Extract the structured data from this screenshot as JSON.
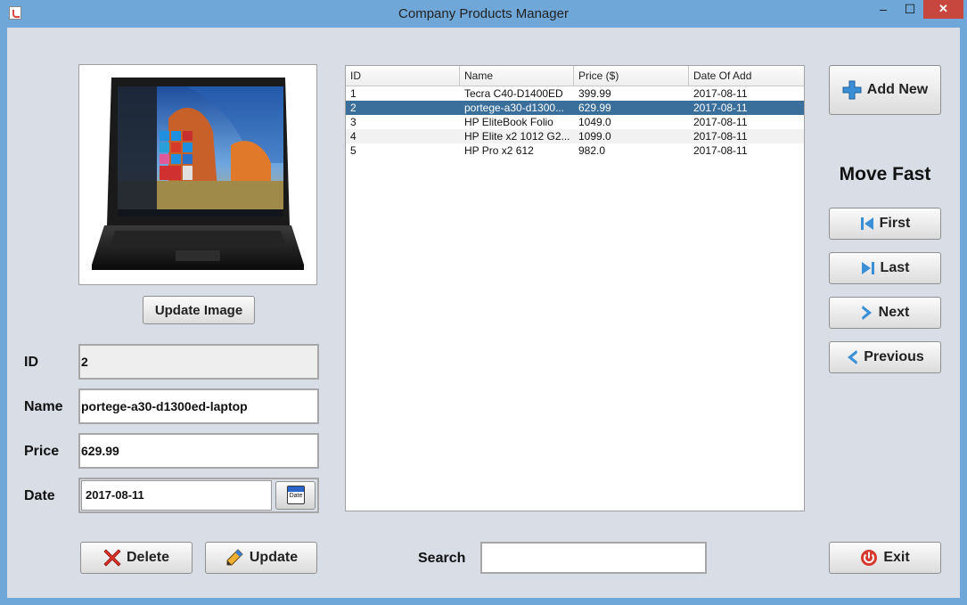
{
  "window": {
    "title": "Company Products Manager",
    "min_glyph": "–",
    "max_glyph": "☐",
    "close_glyph": "✕"
  },
  "image_panel": {
    "update_label": "Update Image"
  },
  "form": {
    "id_label": "ID",
    "id_value": "2",
    "name_label": "Name",
    "name_value": "portege-a30-d1300ed-laptop",
    "price_label": "Price",
    "price_value": "629.99",
    "date_label": "Date",
    "date_value": "2017-08-11",
    "date_button_label": "Date"
  },
  "table": {
    "columns": [
      "ID",
      "Name",
      "Price ($)",
      "Date Of Add"
    ],
    "rows": [
      [
        "1",
        "Tecra C40-D1400ED",
        "399.99",
        "2017-08-11"
      ],
      [
        "2",
        "portege-a30-d1300...",
        "629.99",
        "2017-08-11"
      ],
      [
        "3",
        "HP EliteBook Folio",
        "1049.0",
        "2017-08-11"
      ],
      [
        "4",
        "HP Elite x2 1012 G2...",
        "1099.0",
        "2017-08-11"
      ],
      [
        "5",
        "HP Pro x2 612",
        "982.0",
        "2017-08-11"
      ]
    ],
    "selected_row": 1
  },
  "actions": {
    "add_new": "Add New",
    "heading": "Move Fast",
    "first": "First",
    "last": "Last",
    "next": "Next",
    "previous": "Previous",
    "exit": "Exit",
    "delete": "Delete",
    "update": "Update"
  },
  "search": {
    "label": "Search",
    "value": ""
  },
  "colors": {
    "accent_blue": "#3a8fd6",
    "selected_row": "#3a6f9b",
    "delete_red": "#e0302a",
    "exit_red": "#d63a2e"
  }
}
